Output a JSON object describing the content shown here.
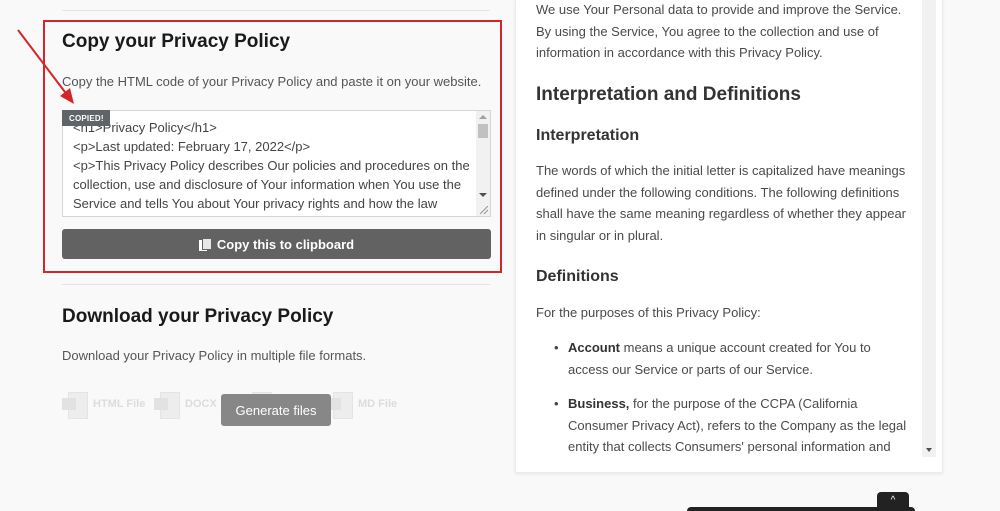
{
  "copy_section": {
    "title": "Copy your Privacy Policy",
    "description": "Copy the HTML code of your Privacy Policy and paste it on your website.",
    "copied_badge": "COPIED!",
    "textarea_lines": [
      "<h1>Privacy Policy</h1>",
      "<p>Last updated: February 17, 2022</p>",
      "<p>This Privacy Policy describes Our policies and procedures on the",
      "collection, use and disclosure of Your information when You use the",
      "Service and tells You about Your privacy rights and how the law"
    ],
    "copy_button_label": "Copy this to clipboard",
    "copy_button_icon": "copy-icon"
  },
  "download_section": {
    "title": "Download your Privacy Policy",
    "description": "Download your Privacy Policy in multiple file formats.",
    "file_options": [
      {
        "label": "HTML File",
        "icon": "html-file-icon"
      },
      {
        "label": "DOCX",
        "icon": "docx-file-icon"
      },
      {
        "label": "",
        "icon": "txt-file-icon"
      },
      {
        "label": "MD File",
        "icon": "md-file-icon"
      }
    ],
    "generate_button_label": "Generate files"
  },
  "preview": {
    "intro_lines": [
      "We use Your Personal data to provide and improve the Service.",
      "By using the Service, You agree to the collection and use of",
      "information in accordance with this Privacy Policy."
    ],
    "heading_interpretation_definitions": "Interpretation and Definitions",
    "heading_interpretation": "Interpretation",
    "interpretation_lines": [
      "The words of which the initial letter is capitalized have meanings",
      "defined under the following conditions. The following definitions",
      "shall have the same meaning regardless of whether they appear",
      "in singular or in plural."
    ],
    "heading_definitions": "Definitions",
    "definitions_intro": "For the purposes of this Privacy Policy:",
    "definitions": [
      {
        "term": "Account",
        "lines": [
          " means a unique account created for You to",
          "access our Service or parts of our Service."
        ]
      },
      {
        "term": "Business,",
        "lines": [
          " for the purpose of the CCPA (California",
          "Consumer Privacy Act), refers to the Company as the legal",
          "entity that collects Consumers' personal information and"
        ]
      }
    ]
  },
  "scroll_top_icon": "chevron-up-icon",
  "scroll_top_glyph": "^",
  "colors": {
    "highlight_border": "#d3262a",
    "copy_button_bg": "#626262",
    "generate_button_bg": "#878787",
    "badge_bg": "#5f6468"
  }
}
